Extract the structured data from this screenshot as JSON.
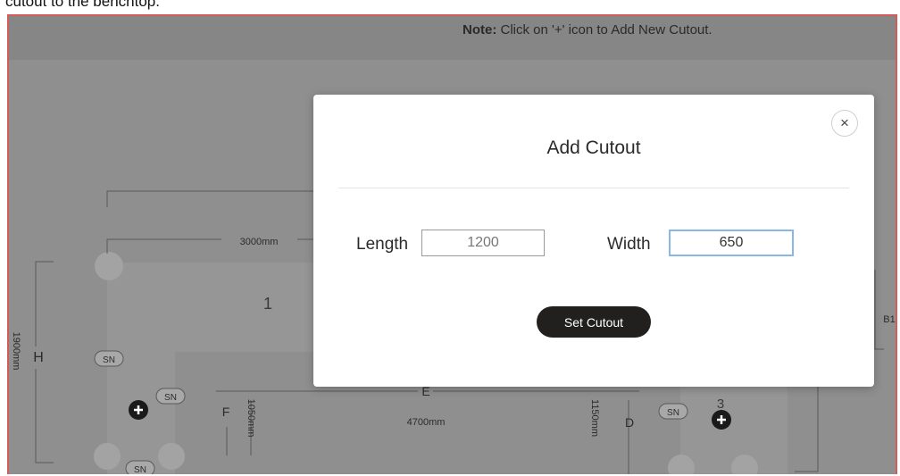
{
  "header_caption": "cutout to the benchtop.",
  "note": {
    "prefix": "Note:",
    "text": " Click on '+' icon to Add New Cutout."
  },
  "plan": {
    "dimensions": {
      "top_length": "3000mm",
      "height": "1900mm",
      "d_length": "1050mm",
      "e_length": "4700mm",
      "f_length": "1150mm"
    },
    "letters": {
      "h": "H",
      "f": "F",
      "e": "E",
      "d": "D",
      "b1": "B1"
    },
    "section_numbers": {
      "one": "1",
      "three": "3"
    },
    "sn_badges": [
      "SN",
      "SN",
      "SN",
      "SN"
    ],
    "add_icon": "plus-circle-icon"
  },
  "modal": {
    "title": "Add Cutout",
    "close_icon": "close-icon",
    "close_glyph": "×",
    "length_label": "Length",
    "length_value": "1200",
    "width_label": "Width",
    "width_value": "650",
    "submit_label": "Set Cutout"
  },
  "colors": {
    "overlay": "#8f8f8f",
    "border": "#d65a5a",
    "button": "#221f1f",
    "focus": "#8ab6e8"
  }
}
